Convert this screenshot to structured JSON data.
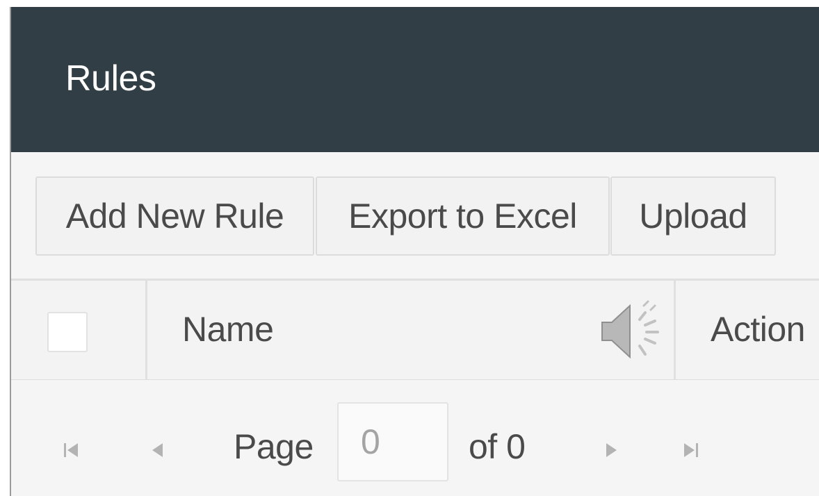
{
  "panel": {
    "title": "Rules"
  },
  "toolbar": {
    "add_label": "Add New Rule",
    "export_label": "Export to Excel",
    "upload_label": "Upload"
  },
  "grid": {
    "columns": [
      "Name",
      "Action"
    ],
    "select_all_checked": false,
    "filter_icon": "speaker-icon"
  },
  "pager": {
    "page_label": "Page",
    "page_value": "0",
    "of_label": "of 0",
    "icons": [
      "first-page-icon",
      "prev-page-icon",
      "next-page-icon",
      "last-page-icon"
    ]
  },
  "colors": {
    "header_bg": "#323e45",
    "panel_bg": "#f5f5f5",
    "text": "#4a4a4a",
    "icon_gray": "#b3b3b3"
  }
}
